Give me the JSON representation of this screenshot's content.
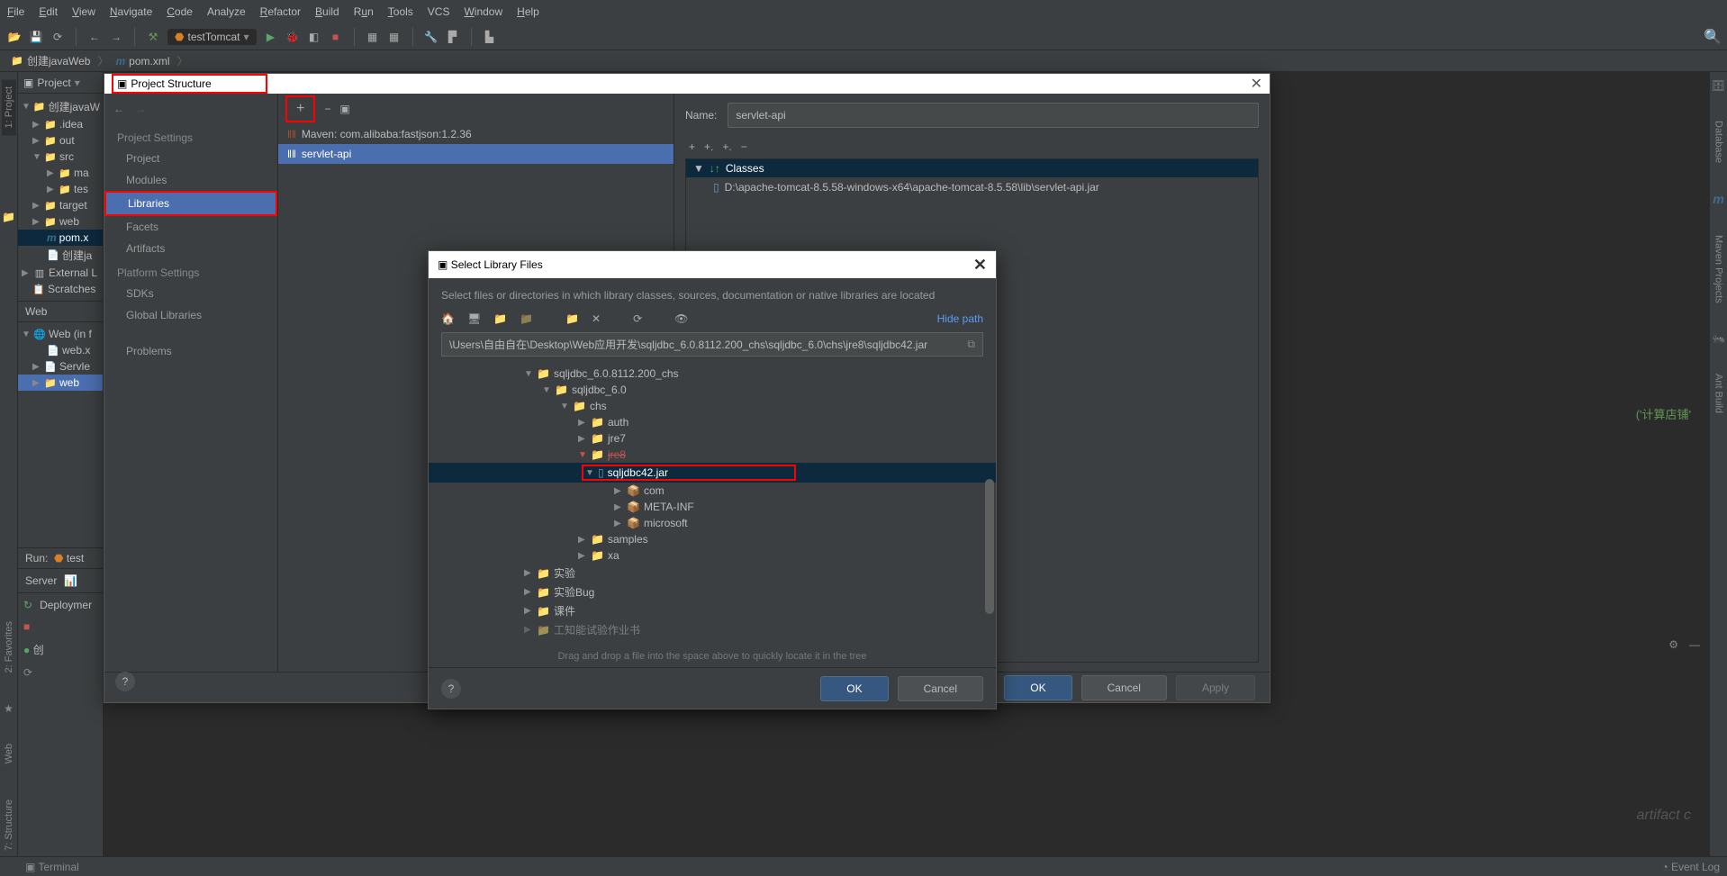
{
  "menu": {
    "file": "File",
    "edit": "Edit",
    "view": "View",
    "navigate": "Navigate",
    "code": "Code",
    "analyze": "Analyze",
    "refactor": "Refactor",
    "build": "Build",
    "run": "Run",
    "tools": "Tools",
    "vcs": "VCS",
    "window": "Window",
    "help": "Help"
  },
  "toolbar": {
    "runConfig": "testTomcat"
  },
  "breadcrumb": {
    "project": "创建javaWeb",
    "file": "pom.xml"
  },
  "projectPanel": {
    "title": "Project"
  },
  "projectTree": {
    "root": "创建javaW",
    "idea": ".idea",
    "out": "out",
    "src": "src",
    "ma": "ma",
    "tes": "tes",
    "target": "target",
    "web": "web",
    "pom": "pom.x",
    "createJa": "创建ja",
    "external": "External L",
    "scratches": "Scratches"
  },
  "webSection": {
    "header": "Web",
    "webIn": "Web (in f",
    "webx": "web.x",
    "servle": "Servle",
    "web": "web"
  },
  "runPanel": {
    "header": "Run:",
    "config": "test",
    "server": "Server",
    "deploy": "Deploymer",
    "msg": "创"
  },
  "leftTabs": {
    "project": "1: Project",
    "favorites": "2: Favorites",
    "web": "Web",
    "structure": "7: Structure"
  },
  "rightTabs": {
    "database": "Database",
    "maven": "Maven Projects",
    "ant": "Ant Build",
    "m": "m"
  },
  "statusbar": {
    "terminal": "Terminal",
    "eventLog": "Event Log"
  },
  "editor": {
    "hint": "('计算店铺'",
    "artifactHint": "artifact c"
  },
  "psDialog": {
    "title": "Project Structure",
    "sections": {
      "projectSettings": "Project Settings",
      "project": "Project",
      "modules": "Modules",
      "libraries": "Libraries",
      "facets": "Facets",
      "artifacts": "Artifacts",
      "platformSettings": "Platform Settings",
      "sdks": "SDKs",
      "globalLibraries": "Global Libraries",
      "problems": "Problems"
    },
    "libs": {
      "maven": "Maven: com.alibaba:fastjson:1.2.36",
      "servlet": "servlet-api"
    },
    "nameLabel": "Name:",
    "nameValue": "servlet-api",
    "classesLabel": "Classes",
    "jarPath": "D:\\apache-tomcat-8.5.58-windows-x64\\apache-tomcat-8.5.58\\lib\\servlet-api.jar",
    "ok": "OK",
    "cancel": "Cancel",
    "apply": "Apply"
  },
  "slfDialog": {
    "title": "Select Library Files",
    "desc": "Select files or directories in which library classes, sources, documentation or native libraries are located",
    "hidePath": "Hide path",
    "path": "\\Users\\自由自在\\Desktop\\Web应用开发\\sqljdbc_6.0.8112.200_chs\\sqljdbc_6.0\\chs\\jre8\\sqljdbc42.jar",
    "tree": {
      "root": "sqljdbc_6.0.8112.200_chs",
      "sqljdbc": "sqljdbc_6.0",
      "chs": "chs",
      "auth": "auth",
      "jre7": "jre7",
      "jre8": "jre8",
      "jar": "sqljdbc42.jar",
      "com": "com",
      "meta": "META-INF",
      "microsoft": "microsoft",
      "samples": "samples",
      "xa": "xa",
      "shiyan": "实验",
      "shiyanBug": "实验Bug",
      "kejian": "课件",
      "unknown": "工知能试验作业书"
    },
    "dragHint": "Drag and drop a file into the space above to quickly locate it in the tree",
    "ok": "OK",
    "cancel": "Cancel"
  }
}
